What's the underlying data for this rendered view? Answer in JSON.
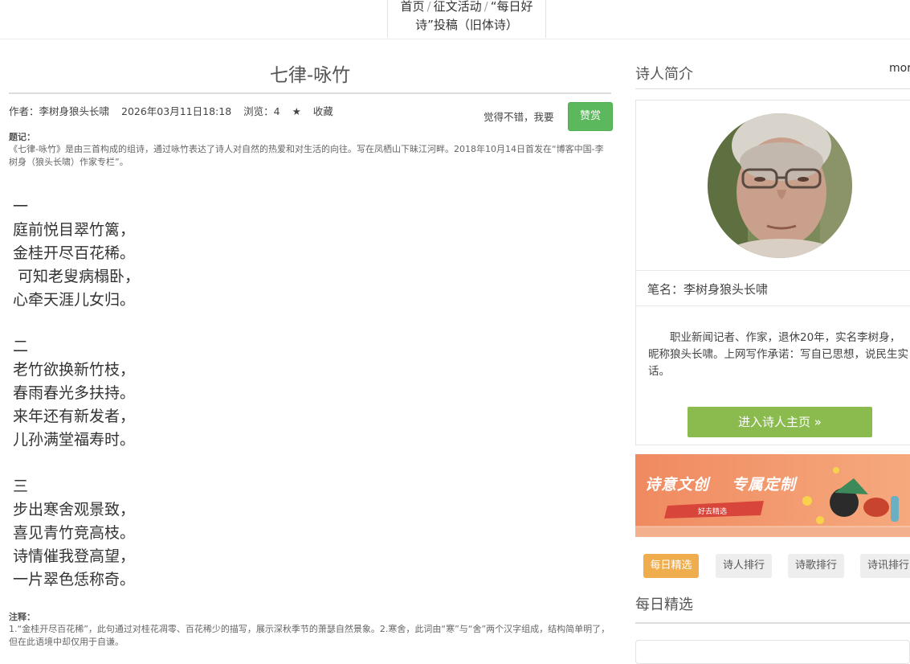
{
  "breadcrumb": {
    "home": "首页",
    "activity": "征文活动",
    "current": "“每日好诗”投稿（旧体诗）",
    "separator": "/"
  },
  "article": {
    "title": "七律-咏竹",
    "author": "作者：李树身狼头长啸",
    "date": "2026年03月11日18:18",
    "views": "浏览：4",
    "favorite": "收藏",
    "praise_prompt": "觉得不错，我要",
    "praise_button": "赞赏",
    "note_label": "题记：",
    "note_text": "《七律-咏竹》是由三首构成的组诗，通过咏竹表达了诗人对自然的热爱和对生活的向往。写在凤栖山下昧江河畔。2018年10月14日首发在“博客中国-李树身（狼头长啸）作家专栏”。",
    "stanzas": [
      {
        "number": "一",
        "lines": [
          "庭前悦目翠竹篱，",
          "金桂开尽百花稀。",
          " 可知老叟病榻卧，",
          "心牵天涯儿女归。"
        ]
      },
      {
        "number": "二",
        "lines": [
          "老竹欲换新竹枝，",
          "春雨春光多扶持。",
          "来年还有新发者，",
          "儿孙满堂福寿时。"
        ]
      },
      {
        "number": "三",
        "lines": [
          "步出寒舍观景致，",
          "喜见青竹竞高枝。",
          "诗情催我登高望，",
          "一片翠色恁称奇。"
        ]
      }
    ],
    "annotation_label": "注释：",
    "annotation_text": "1.“金桂开尽百花稀”，此句通过对桂花凋零、百花稀少的描写，展示深秋季节的萧瑟自然景象。2.寒舍，此词由“寒”与“舍”两个汉字组成，结构简单明了，但在此语境中却仅用于自谦。"
  },
  "sidebar": {
    "heading": "诗人简介",
    "more": "more",
    "pen_name": "笔名：李树身狼头长啸",
    "bio": "职业新闻记者、作家，退休20年，实名李树身，昵称狼头长啸。上网写作承诺：写自已思想，说民生实话。",
    "home_button": "进入诗人主页 »",
    "banner_text_1": "诗意文创",
    "banner_text_2": "专属定制",
    "banner_tag": "好去精选",
    "tabs": [
      "每日精选",
      "诗人排行",
      "诗歌排行",
      "诗讯排行"
    ],
    "daily_heading": "每日精选"
  },
  "colors": {
    "praise_green": "#5cb85c",
    "home_button_green": "#8bbb4f",
    "active_tab_orange": "#f0ad4e"
  }
}
